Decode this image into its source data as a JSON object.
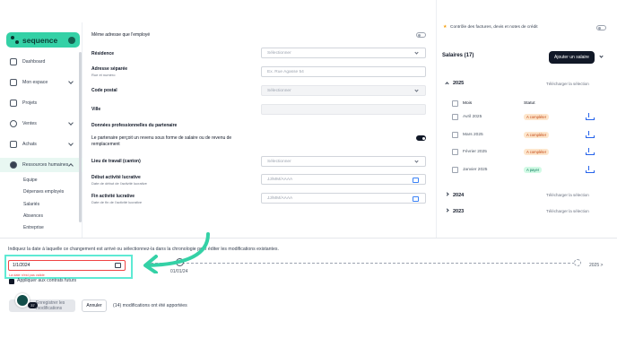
{
  "brand": {
    "name": "sequence"
  },
  "sidebar": {
    "items": [
      {
        "label": "Dashboard"
      },
      {
        "label": "Mon espace"
      },
      {
        "label": "Projets"
      },
      {
        "label": "Ventes"
      },
      {
        "label": "Achats"
      },
      {
        "label": "Ressources humaines"
      }
    ],
    "sub_items": [
      {
        "label": "Equipe"
      },
      {
        "label": "Dépenses employés"
      },
      {
        "label": "Salariés"
      },
      {
        "label": "Absences"
      },
      {
        "label": "Entreprise"
      }
    ]
  },
  "form": {
    "same_address": "Même adresse que l'employé",
    "residence_label": "Résidence",
    "residence_placeholder": "Sélectionner",
    "address_label": "Adresse séparée",
    "address_sub": "Rue et numéro",
    "address_placeholder": "Ex. Rue Agasse 54",
    "postal_label": "Code postal",
    "postal_placeholder": "Sélectionner",
    "city_label": "Ville",
    "partner_heading": "Données professionnelles du partenaire",
    "partner_income": "Le partenaire perçoit un revenu sous forme de salaire ou de revenu de remplacement",
    "work_place_label": "Lieu de travail (canton)",
    "work_place_placeholder": "Sélectionner",
    "start_label": "Début activité lucrative",
    "start_sub": "Date de début de l'activité lucrative",
    "start_placeholder": "JJ/MM/AAAA",
    "end_label": "Fin activité lucrative",
    "end_sub": "Date de fin de l'activité lucrative",
    "end_placeholder": "JJ/MM/AAAA"
  },
  "right_panel": {
    "top_text": "Contrôle des factures, devis et notes de crédit",
    "salaries_title": "Salaires (17)",
    "add_button": "Ajouter un salaire",
    "download_link": "Télécharger la sélection",
    "years": [
      "2025",
      "2024",
      "2023"
    ],
    "col_month": "Mois",
    "col_status": "Statut",
    "rows": [
      {
        "month": "Avril 2025",
        "status": "A compléter",
        "color": "#fde6cc"
      },
      {
        "month": "Mars 2025",
        "status": "A compléter",
        "color": "#fde6cc"
      },
      {
        "month": "Février 2025",
        "status": "A compléter",
        "color": "#fde6cc"
      },
      {
        "month": "Janvier 2025",
        "status": "A payer",
        "color": "#d1fae5"
      }
    ]
  },
  "bottom": {
    "hint": "Indiquez la date à laquelle ce changement est arrivé ou sélectionnez-la dans la chronologie pour éditer les modifications existantes.",
    "date_value": "1/1/2024",
    "error": "La date n'est pas valide",
    "timeline_date": "01/01/24",
    "timeline_end": "2025 >",
    "apply_future": "Appliquer aux contrats futurs",
    "save_button": "Enregistrer les modifications",
    "cancel_button": "Annuler",
    "modifications": "(14) modifications ont été apportées",
    "helper_count": "37"
  },
  "colors": {
    "brand": "#34d1a6",
    "highlight": "#5eead4",
    "annotation_arrow": "#34d1a6",
    "error": "#ef4444"
  }
}
